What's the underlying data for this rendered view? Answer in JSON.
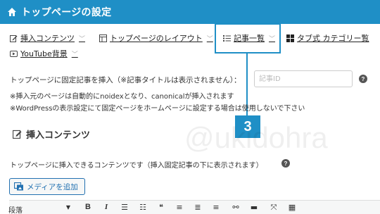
{
  "header": {
    "title": "トップページの設定"
  },
  "tabs": [
    {
      "label": "挿入コンテンツ",
      "icon": "edit-icon"
    },
    {
      "label": "トップページのレイアウト",
      "icon": "layout-icon"
    },
    {
      "label": "記事一覧",
      "icon": "list-icon"
    },
    {
      "label": "タブ式 カテゴリー覧",
      "icon": "grid-icon"
    },
    {
      "label": "YouTube背景",
      "icon": "youtube-icon"
    }
  ],
  "callout": {
    "number": "3"
  },
  "insert": {
    "label": "トップページに固定記事を挿入（※記事タイトルは表示されません）：",
    "placeholder": "記事ID"
  },
  "notes": [
    "※挿入元のページは自動的にnoidexとなり、canonicalが挿入されます",
    "※WordPressの表示設定にて固定ページをホームページに設定する場合は使用しないで下さい"
  ],
  "section": {
    "title": "挿入コンテンツ",
    "description": "トップページに挿入できるコンテンツです（挿入固定記事の下に表示されます）"
  },
  "watermark": "@ukidohra",
  "media_button": {
    "label": "メディアを追加"
  },
  "editor": {
    "format_select": "段落",
    "toolbar_icons": [
      "B",
      "I",
      "☰",
      "☷",
      "❝",
      "≡",
      "≣",
      "≡",
      "⚯",
      "▬",
      "⤧",
      "▦"
    ]
  },
  "colors": {
    "accent": "#1f8fc6",
    "header_bg": "#1f8fc6",
    "link_blue": "#2271b1"
  }
}
